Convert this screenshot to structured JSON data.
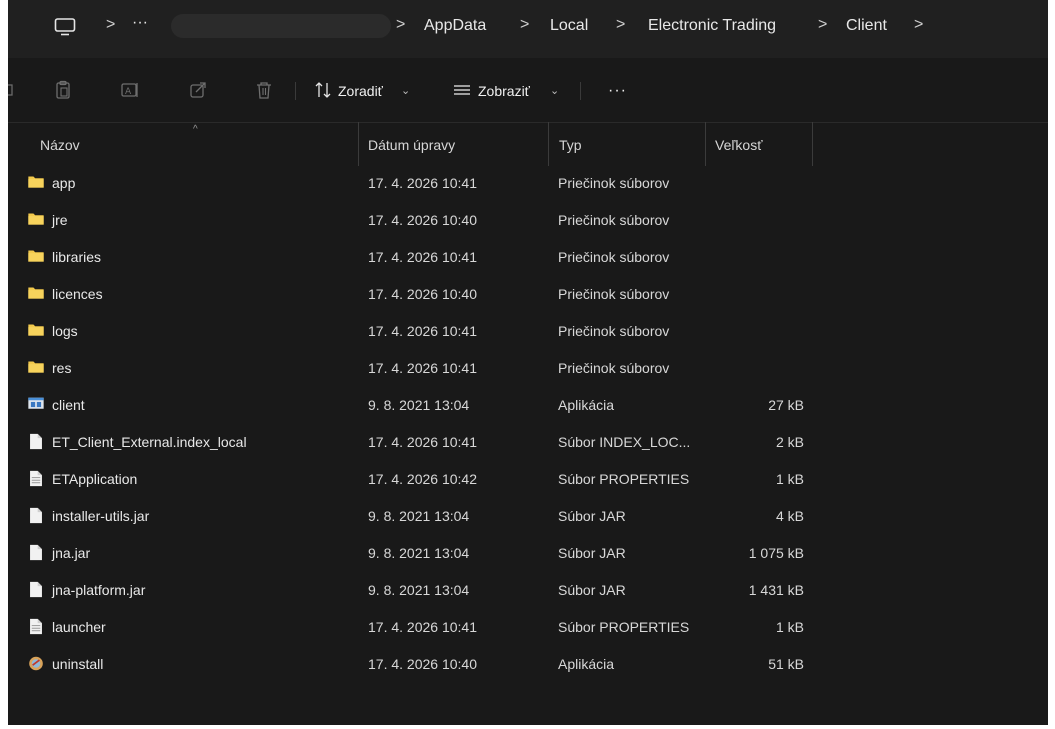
{
  "breadcrumb": {
    "ellipsis": "···",
    "separator": ">",
    "items": [
      "AppData",
      "Local",
      "Electronic Trading",
      "Client"
    ]
  },
  "toolbar": {
    "sort_label": "Zoradiť",
    "view_label": "Zobraziť",
    "more_label": "···"
  },
  "columns": {
    "name": "Názov",
    "date": "Dátum úpravy",
    "type": "Typ",
    "size": "Veľkosť"
  },
  "files": [
    {
      "name": "app",
      "date": "17. 4. 2026 10:41",
      "type": "Priečinok súborov",
      "size": "",
      "icon": "folder-icon"
    },
    {
      "name": "jre",
      "date": "17. 4. 2026 10:40",
      "type": "Priečinok súborov",
      "size": "",
      "icon": "folder-icon"
    },
    {
      "name": "libraries",
      "date": "17. 4. 2026 10:41",
      "type": "Priečinok súborov",
      "size": "",
      "icon": "folder-icon"
    },
    {
      "name": "licences",
      "date": "17. 4. 2026 10:40",
      "type": "Priečinok súborov",
      "size": "",
      "icon": "folder-icon"
    },
    {
      "name": "logs",
      "date": "17. 4. 2026 10:41",
      "type": "Priečinok súborov",
      "size": "",
      "icon": "folder-icon"
    },
    {
      "name": "res",
      "date": "17. 4. 2026 10:41",
      "type": "Priečinok súborov",
      "size": "",
      "icon": "folder-icon"
    },
    {
      "name": "client",
      "date": "9. 8. 2021 13:04",
      "type": "Aplikácia",
      "size": "27 kB",
      "icon": "application-icon"
    },
    {
      "name": "ET_Client_External.index_local",
      "date": "17. 4. 2026 10:41",
      "type": "Súbor INDEX_LOC...",
      "size": "2 kB",
      "icon": "file-icon"
    },
    {
      "name": "ETApplication",
      "date": "17. 4. 2026 10:42",
      "type": "Súbor PROPERTIES",
      "size": "1 kB",
      "icon": "text-file-icon"
    },
    {
      "name": "installer-utils.jar",
      "date": "9. 8. 2021 13:04",
      "type": "Súbor JAR",
      "size": "4 kB",
      "icon": "file-icon"
    },
    {
      "name": "jna.jar",
      "date": "9. 8. 2021 13:04",
      "type": "Súbor JAR",
      "size": "1 075 kB",
      "icon": "file-icon"
    },
    {
      "name": "jna-platform.jar",
      "date": "9. 8. 2021 13:04",
      "type": "Súbor JAR",
      "size": "1 431 kB",
      "icon": "file-icon"
    },
    {
      "name": "launcher",
      "date": "17. 4. 2026 10:41",
      "type": "Súbor PROPERTIES",
      "size": "1 kB",
      "icon": "text-file-icon"
    },
    {
      "name": "uninstall",
      "date": "17. 4. 2026 10:40",
      "type": "Aplikácia",
      "size": "51 kB",
      "icon": "uninstall-app-icon"
    }
  ],
  "colors": {
    "background": "#191919",
    "address_bar": "#202020",
    "folder": "#f2c94c",
    "text": "#e9e9e9"
  }
}
